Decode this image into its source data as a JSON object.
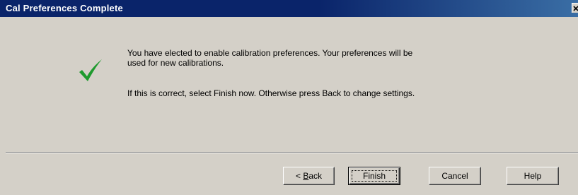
{
  "window": {
    "title": "Cal Preferences Complete"
  },
  "message": {
    "line1": "You have elected to enable calibration preferences.  Your preferences will be",
    "line2": "used for new calibrations.",
    "line3": "If this is correct, select Finish now.  Otherwise press Back to change settings."
  },
  "icons": {
    "status": "check-icon",
    "close": "close-icon"
  },
  "colors": {
    "titlebar": "#0a246a",
    "check": "#1e9a2e",
    "face": "#d4d0c8"
  },
  "buttons": {
    "back_prefix": "< ",
    "back_accel": "B",
    "back_rest": "ack",
    "finish": "Finish",
    "cancel": "Cancel",
    "help": "Help"
  }
}
